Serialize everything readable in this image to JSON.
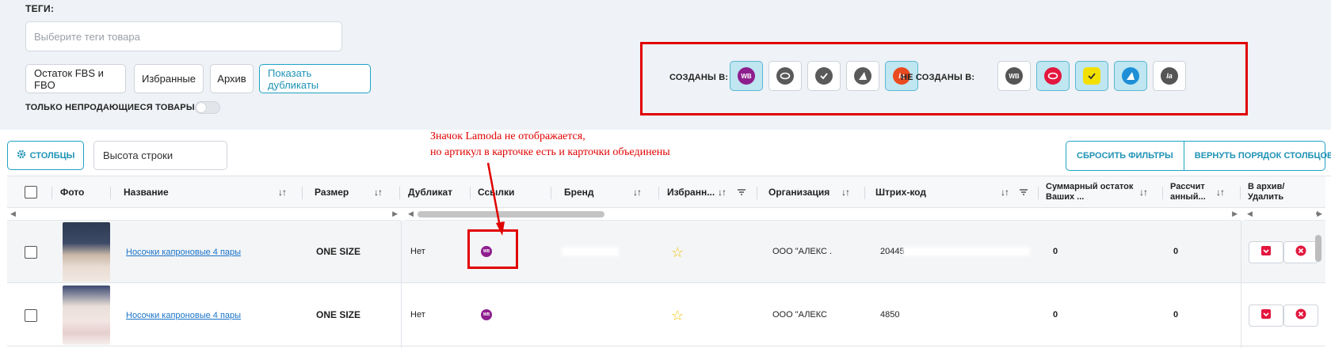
{
  "filters": {
    "tags_label": "ТЕГИ:",
    "tags_placeholder": "Выберите теги товара",
    "buttons": [
      "Остаток FBS и FBO",
      "Избранные",
      "Архив",
      "Показать дубликаты"
    ],
    "only_unsold_label": "ТОЛЬКО НЕПРОДАЮЩИЕСЯ ТОВАРЫ",
    "created_in_label": "СОЗДАНЫ В:",
    "not_created_in_label": "НЕ СОЗДАНЫ В:",
    "created_in_icons": [
      {
        "name": "wb",
        "text": "WB",
        "color": "#8e1e8e",
        "selected": true
      },
      {
        "name": "ozon",
        "text": "",
        "color": "#555555",
        "selected": false
      },
      {
        "name": "sber",
        "text": "",
        "color": "#555555",
        "selected": false
      },
      {
        "name": "yandex",
        "text": "",
        "color": "#555555",
        "selected": false
      },
      {
        "name": "lamoda",
        "text": "la",
        "color": "#ea4a1f",
        "selected": true
      }
    ],
    "not_created_in_icons": [
      {
        "name": "wb",
        "text": "WB",
        "color": "#555555",
        "selected": false
      },
      {
        "name": "ozon",
        "text": "",
        "color": "#e3173e",
        "selected": true
      },
      {
        "name": "sber",
        "text": "",
        "color": "#f3e000",
        "selected": true
      },
      {
        "name": "yandex",
        "text": "",
        "color": "#1e8fd6",
        "selected": true
      },
      {
        "name": "lamoda",
        "text": "la",
        "color": "#555555",
        "selected": false
      }
    ]
  },
  "toolbar": {
    "columns_label": "СТОЛБЦЫ",
    "row_height_label": "Высота строки",
    "reset_filters_label": "СБРОСИТЬ ФИЛЬТРЫ",
    "reset_order_label": "ВЕРНУТЬ ПОРЯДОК СТОЛБЦОВ"
  },
  "annotation": {
    "line1": "Значок Lamoda не отображается,",
    "line2": "но артикул в карточке есть и карточки объединены"
  },
  "table": {
    "headers": {
      "photo": "Фото",
      "name": "Название",
      "size": "Размер",
      "duplicate": "Дубликат",
      "links": "Ссылки",
      "brand": "Бренд",
      "favorites": "Избранн...",
      "organization": "Организация",
      "barcode": "Штрих-код",
      "total_stock": "Суммарный остаток Ваших ...",
      "calculated": "Рассчит анный...",
      "archive_delete": "В архив/ Удалить"
    },
    "sort_icon": "↓↑",
    "rows": [
      {
        "name": "Носочки капроновые 4 пары",
        "size": "ONE SIZE",
        "duplicate": "Нет",
        "link_icon": "WB",
        "organization": "ООО \"АЛЕКС .",
        "barcode": "20445",
        "total_stock": "0",
        "calculated": "0"
      },
      {
        "name": "Носочки капроновые 4 пары",
        "size": "ONE SIZE",
        "duplicate": "Нет",
        "link_icon": "WB",
        "organization": "ООО \"АЛЕКС",
        "barcode": "4850",
        "total_stock": "0",
        "calculated": "0"
      }
    ]
  }
}
